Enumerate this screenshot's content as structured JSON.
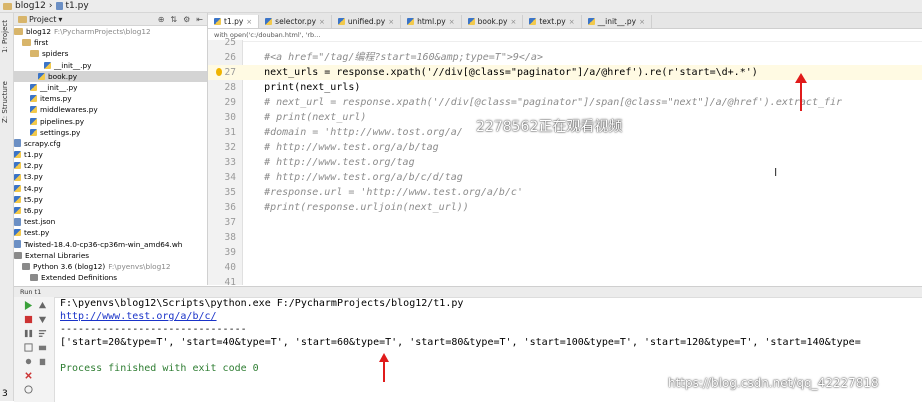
{
  "topbar": {
    "project": "blog12",
    "file": "t1.py"
  },
  "leftstrip": {
    "project_tab": "1: Project",
    "structure_tab": "Z: Structure"
  },
  "project_panel": {
    "selector": "Project",
    "items": [
      {
        "label": "blog12",
        "extra": "F:\\PycharmProjects\\blog12",
        "kind": "folder"
      },
      {
        "label": "first",
        "kind": "folder"
      },
      {
        "label": "spiders",
        "kind": "folder"
      },
      {
        "label": "__init__.py",
        "kind": "py"
      },
      {
        "label": "book.py",
        "kind": "py"
      },
      {
        "label": "__init__.py",
        "kind": "py"
      },
      {
        "label": "items.py",
        "kind": "py"
      },
      {
        "label": "middlewares.py",
        "kind": "py"
      },
      {
        "label": "pipelines.py",
        "kind": "py"
      },
      {
        "label": "settings.py",
        "kind": "py"
      },
      {
        "label": "scrapy.cfg",
        "kind": "file"
      },
      {
        "label": "t1.py",
        "kind": "py"
      },
      {
        "label": "t2.py",
        "kind": "py"
      },
      {
        "label": "t3.py",
        "kind": "py"
      },
      {
        "label": "t4.py",
        "kind": "py"
      },
      {
        "label": "t5.py",
        "kind": "py"
      },
      {
        "label": "t6.py",
        "kind": "py"
      },
      {
        "label": "test.json",
        "kind": "file"
      },
      {
        "label": "test.py",
        "kind": "py"
      },
      {
        "label": "Twisted-18.4.0-cp36-cp36m-win_amd64.wh",
        "kind": "file"
      },
      {
        "label": "External Libraries",
        "kind": "lib"
      },
      {
        "label": "Python 3.6 (blog12)",
        "extra": "F:\\pyenvs\\blog12",
        "kind": "lib"
      },
      {
        "label": "Extended Definitions",
        "kind": "lib"
      }
    ]
  },
  "tabs": [
    {
      "label": "t1.py",
      "active": true
    },
    {
      "label": "selector.py",
      "active": false
    },
    {
      "label": "unified.py",
      "active": false
    },
    {
      "label": "html.py",
      "active": false
    },
    {
      "label": "book.py",
      "active": false
    },
    {
      "label": "text.py",
      "active": false
    },
    {
      "label": "__init__.py",
      "active": false
    }
  ],
  "breadcrumb": "with open('c:/douban.html', 'rb...",
  "code": [
    {
      "n": "25",
      "text": ""
    },
    {
      "n": "26",
      "text": "    #<a href=\"/tag/编程?start=160&amp;type=T\">9</a>"
    },
    {
      "n": "27",
      "text": "    next_urls = response.xpath('//div[@class=\"paginator\"]/a/@href').re(r'start=\\d+.*')"
    },
    {
      "n": "28",
      "text": "    print(next_urls)"
    },
    {
      "n": "29",
      "text": "    # next_url = response.xpath('//div[@class=\"paginator\"]/span[@class=\"next\"]/a/@href').extract_fir"
    },
    {
      "n": "30",
      "text": "    # print(next_url)"
    },
    {
      "n": "31",
      "text": "    #domain = 'http://www.tost.org/a/"
    },
    {
      "n": "32",
      "text": "    # http://www.test.org/a/b/tag"
    },
    {
      "n": "33",
      "text": "    # http://www.test.org/tag"
    },
    {
      "n": "34",
      "text": "    # http://www.test.org/a/b/c/d/tag"
    },
    {
      "n": "35",
      "text": "    #response.url = 'http://www.test.org/a/b/c'"
    },
    {
      "n": "36",
      "text": "    #print(response.urljoin(next_url))"
    },
    {
      "n": "37",
      "text": ""
    },
    {
      "n": "38",
      "text": ""
    },
    {
      "n": "39",
      "text": ""
    },
    {
      "n": "40",
      "text": ""
    },
    {
      "n": "41",
      "text": ""
    },
    {
      "n": "42",
      "text": ""
    }
  ],
  "watermark_top": "2278562正在观看视频",
  "run": {
    "header": "Run  t1",
    "lines": [
      "F:\\pyenvs\\blog12\\Scripts\\python.exe F:/PycharmProjects/blog12/t1.py",
      "http://www.test.org/a/b/c/",
      "-------------------------------",
      "['start=20&type=T', 'start=40&type=T', 'start=60&type=T', 'start=80&type=T', 'start=100&type=T', 'start=120&type=T', 'start=140&type=",
      "",
      "Process finished with exit code 0"
    ]
  },
  "watermark_bottom": "https://blog.csdn.net/qq_42227818",
  "page_number": "3",
  "colors": {
    "arrow": "#e01b1b",
    "string": "#067d17",
    "comment": "#8c8c8c",
    "highlight": "#fffae3"
  }
}
